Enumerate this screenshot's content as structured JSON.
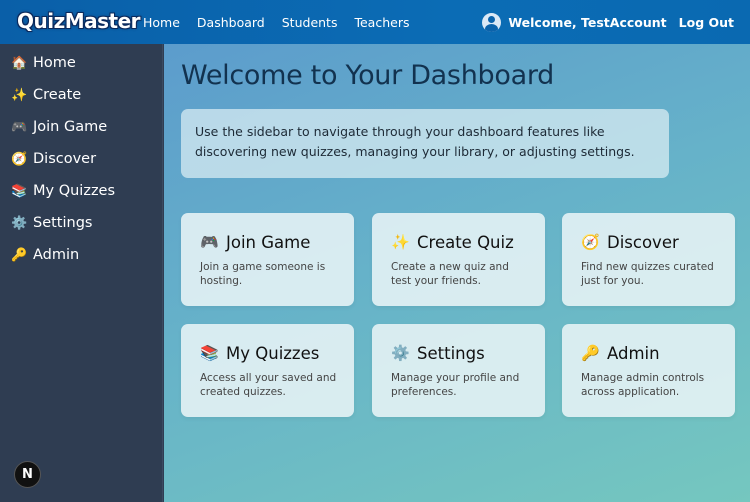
{
  "header": {
    "logo": "QuizMaster",
    "nav": [
      "Home",
      "Dashboard",
      "Students",
      "Teachers"
    ],
    "welcome": "Welcome, TestAccount",
    "logout": "Log Out"
  },
  "sidebar": {
    "items": [
      {
        "icon": "🏠",
        "label": "Home"
      },
      {
        "icon": "✨",
        "label": "Create"
      },
      {
        "icon": "🎮",
        "label": "Join Game"
      },
      {
        "icon": "🧭",
        "label": "Discover"
      },
      {
        "icon": "📚",
        "label": "My Quizzes"
      },
      {
        "icon": "⚙️",
        "label": "Settings"
      },
      {
        "icon": "🔑",
        "label": "Admin"
      }
    ],
    "badge": "N"
  },
  "main": {
    "title": "Welcome to Your Dashboard",
    "intro": "Use the sidebar to navigate through your dashboard features like discovering new quizzes, managing your library, or adjusting settings.",
    "cards": [
      {
        "icon": "🎮",
        "title": "Join Game",
        "desc": "Join a game someone is hosting."
      },
      {
        "icon": "✨",
        "title": "Create Quiz",
        "desc": "Create a new quiz and test your friends."
      },
      {
        "icon": "🧭",
        "title": "Discover",
        "desc": "Find new quizzes curated just for you."
      },
      {
        "icon": "📚",
        "title": "My Quizzes",
        "desc": "Access all your saved and created quizzes."
      },
      {
        "icon": "⚙️",
        "title": "Settings",
        "desc": "Manage your profile and preferences."
      },
      {
        "icon": "🔑",
        "title": "Admin",
        "desc": "Manage admin controls across application."
      }
    ]
  }
}
